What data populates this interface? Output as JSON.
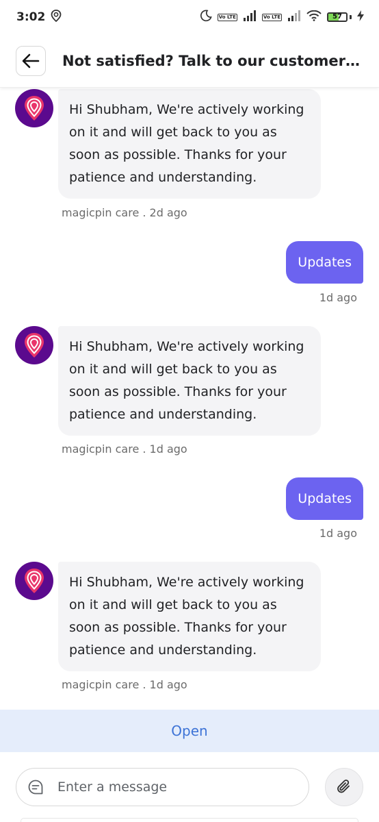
{
  "status_bar": {
    "time": "3:02",
    "battery": "57",
    "battery_level": 0.57,
    "volte_label": "Vo LTE",
    "icons": [
      "location-icon",
      "moon-icon",
      "signal-icon",
      "wifi-icon",
      "battery-icon",
      "charging-icon"
    ]
  },
  "header": {
    "title": "Not satisfied? Talk to our customer se..."
  },
  "messages": [
    {
      "direction": "in",
      "text": "Hi Shubham, We're actively working on it and will get back to you as soon as possible. Thanks for your patience and understanding.",
      "meta": "magicpin care . 2d ago"
    },
    {
      "direction": "out",
      "text": "Updates",
      "meta": "1d ago"
    },
    {
      "direction": "in",
      "text": "Hi Shubham, We're actively working on it and will get back to you as soon as possible. Thanks for your patience and understanding.",
      "meta": "magicpin care . 1d ago"
    },
    {
      "direction": "out",
      "text": "Updates",
      "meta": "1d ago"
    },
    {
      "direction": "in",
      "text": "Hi Shubham, We're actively working on it and will get back to you as soon as possible. Thanks for your patience and understanding.",
      "meta": "magicpin care . 1d ago"
    }
  ],
  "ticket_status": "Open",
  "composer": {
    "placeholder": "Enter a message",
    "value": ""
  },
  "colors": {
    "accent": "#6c63f0",
    "avatar_bg": "#5b0a8e",
    "status_strip_bg": "#e5edfb",
    "status_strip_text": "#3d73d6"
  }
}
